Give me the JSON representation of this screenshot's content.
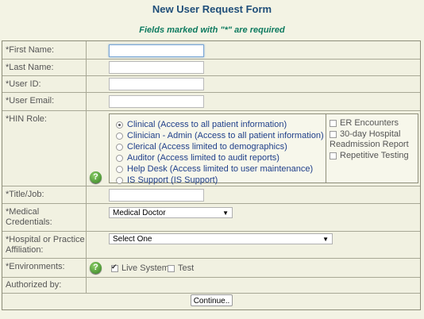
{
  "header": {
    "title": "New User Request Form",
    "required_note": "Fields marked with \"*\" are required"
  },
  "fields": {
    "first_name": {
      "label": "*First Name:",
      "value": ""
    },
    "last_name": {
      "label": "*Last Name:",
      "value": ""
    },
    "user_id": {
      "label": "*User ID:",
      "value": ""
    },
    "user_email": {
      "label": "*User Email:",
      "value": ""
    },
    "hin_role": {
      "label": "*HIN Role:"
    },
    "title_job": {
      "label": "*Title/Job:",
      "value": ""
    },
    "medical_credentials": {
      "label": "*Medical Credentials:",
      "selected": "Medical Doctor"
    },
    "hospital": {
      "label": "*Hospital or Practice Affiliation:",
      "selected": "Select One"
    },
    "environments": {
      "label": "*Environments:"
    },
    "authorized_by": {
      "label": "Authorized by:"
    }
  },
  "roles": [
    {
      "label": "Clinical (Access to all patient information)",
      "checked": true
    },
    {
      "label": "Clinician - Admin (Access to all patient information)",
      "checked": false
    },
    {
      "label": "Clerical (Access limited to demographics)",
      "checked": false
    },
    {
      "label": "Auditor (Access limited to audit reports)",
      "checked": false
    },
    {
      "label": "Help Desk (Access limited to user maintenance)",
      "checked": false
    },
    {
      "label": "IS Support (IS Support)",
      "checked": false
    }
  ],
  "role_options": {
    "er_encounters": "ER Encounters",
    "readmission": "30-day Hospital Readmission Report",
    "repetitive_testing": "Repetitive Testing"
  },
  "environments": {
    "live_system": {
      "label": "Live System",
      "checked": true
    },
    "test": {
      "label": "Test",
      "checked": false
    }
  },
  "help_icon_glyph": "?",
  "actions": {
    "continue": "Continue.."
  },
  "colors": {
    "title": "#1f4e79",
    "required_note": "#0d7a5f",
    "role_text": "#1f3f8a",
    "background": "#f3f3e4",
    "help_icon": "#2f7d1e"
  }
}
